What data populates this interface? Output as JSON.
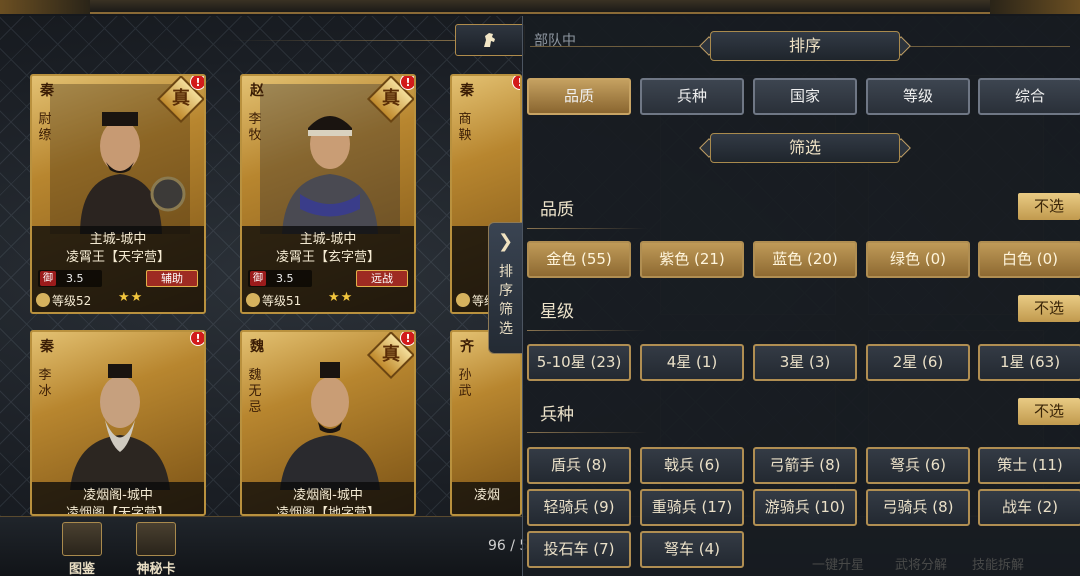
{
  "cards": [
    {
      "nation": "秦",
      "name": "尉缭",
      "quality": "真",
      "loc1": "主城-城中",
      "loc2": "凌霄王【天字营】",
      "def": "3.5",
      "role": "辅助",
      "level": "等级52",
      "stars": "★★"
    },
    {
      "nation": "赵",
      "name": "李牧",
      "quality": "真",
      "loc1": "主城-城中",
      "loc2": "凌霄王【玄字营】",
      "def": "3.5",
      "role": "远战",
      "level": "等级51",
      "stars": "★★"
    },
    {
      "nation": "秦",
      "name": "商鞅",
      "loc1": "",
      "def": "",
      "level": "等级"
    },
    {
      "nation": "秦",
      "name": "李冰",
      "loc1": "凌烟阁-城中",
      "loc2": "凌烟阁【天字营】"
    },
    {
      "nation": "魏",
      "name": "魏无忌",
      "quality": "真",
      "loc1": "凌烟阁-城中",
      "loc2": "凌烟阁【地字营】"
    },
    {
      "nation": "齐",
      "name": "孙武",
      "loc1": "凌烟"
    }
  ],
  "header": {
    "subtitle": "部队中"
  },
  "side_tab": {
    "label": "排序筛选"
  },
  "bottom": {
    "tujian": "图鉴",
    "mystery": "神秘卡",
    "count": "96 / 5",
    "ghost_actions": [
      "一键升星",
      "武将分解",
      "技能拆解"
    ]
  },
  "panel": {
    "sort_title": "排序",
    "sort_tabs": [
      "品质",
      "兵种",
      "国家",
      "等级",
      "综合"
    ],
    "sort_selected": "品质",
    "filter_title": "筛选",
    "groups": [
      {
        "label": "品质",
        "deselect": "不选",
        "options": [
          "金色 (55)",
          "紫色 (21)",
          "蓝色 (20)",
          "绿色 (0)",
          "白色 (0)"
        ],
        "selected": [
          "金色 (55)",
          "紫色 (21)",
          "蓝色 (20)",
          "绿色 (0)",
          "白色 (0)"
        ]
      },
      {
        "label": "星级",
        "deselect": "不选",
        "options": [
          "5-10星 (23)",
          "4星 (1)",
          "3星 (3)",
          "2星 (6)",
          "1星 (63)"
        ]
      },
      {
        "label": "兵种",
        "deselect": "不选",
        "options": [
          "盾兵 (8)",
          "戟兵 (6)",
          "弓箭手 (8)",
          "弩兵 (6)",
          "策士 (11)",
          "轻骑兵 (9)",
          "重骑兵 (17)",
          "游骑兵 (10)",
          "弓骑兵 (8)",
          "战车 (2)",
          "投石车 (7)",
          "弩车 (4)"
        ]
      }
    ]
  }
}
